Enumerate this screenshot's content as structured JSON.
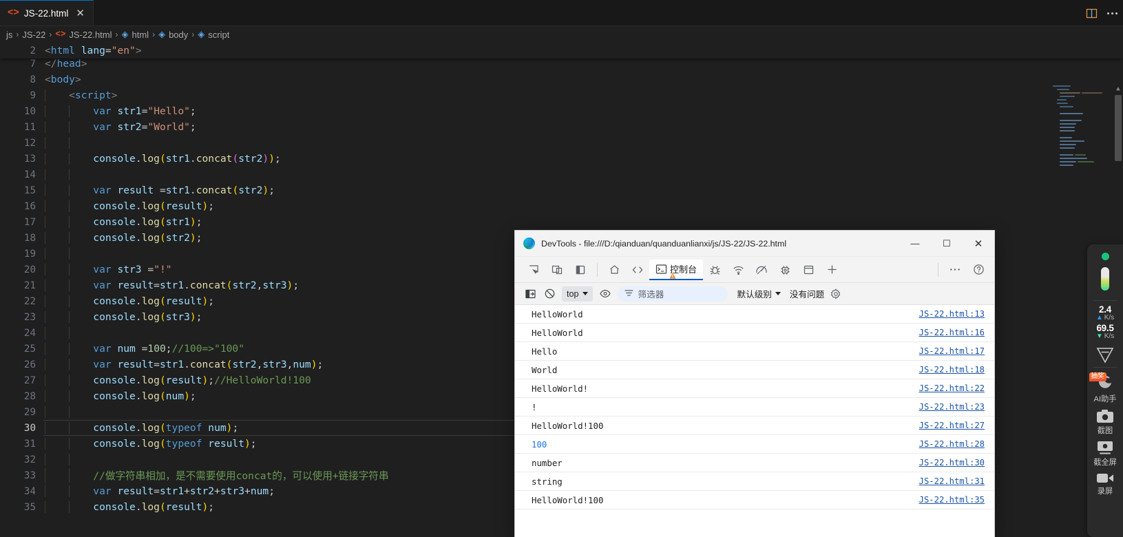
{
  "editor": {
    "tab": {
      "label": "JS-22.html",
      "icon": "html5-icon",
      "close_icon": "close-icon"
    },
    "titlebar_actions": {
      "split_label": "split-editor-icon",
      "more_label": "more-actions-icon"
    },
    "breadcrumb": [
      {
        "label": "js",
        "icon": "folder"
      },
      {
        "label": "JS-22",
        "icon": "folder"
      },
      {
        "label": "JS-22.html",
        "icon": "html5-icon"
      },
      {
        "label": "html",
        "icon": "symbol-cube-icon"
      },
      {
        "label": "body",
        "icon": "symbol-cube-icon"
      },
      {
        "label": "script",
        "icon": "symbol-cube-icon"
      }
    ],
    "breadcrumb_separator": "›",
    "current_line": 30,
    "lines": [
      {
        "n": "2",
        "sticky": true
      },
      {
        "n": "7"
      },
      {
        "n": "8"
      },
      {
        "n": "9"
      },
      {
        "n": "10"
      },
      {
        "n": "11"
      },
      {
        "n": "12"
      },
      {
        "n": "13"
      },
      {
        "n": "14"
      },
      {
        "n": "15"
      },
      {
        "n": "16"
      },
      {
        "n": "17"
      },
      {
        "n": "18"
      },
      {
        "n": "19"
      },
      {
        "n": "20"
      },
      {
        "n": "21"
      },
      {
        "n": "22"
      },
      {
        "n": "23"
      },
      {
        "n": "24"
      },
      {
        "n": "25"
      },
      {
        "n": "26"
      },
      {
        "n": "27"
      },
      {
        "n": "28"
      },
      {
        "n": "29"
      },
      {
        "n": "30"
      },
      {
        "n": "31"
      },
      {
        "n": "32"
      },
      {
        "n": "33"
      },
      {
        "n": "34"
      },
      {
        "n": "35"
      }
    ],
    "code_plain": [
      "<html lang=\"en\">",
      "</head>",
      "<body>",
      "    <script>",
      "        var str1=\"Hello\";",
      "        var str2=\"World\";",
      "",
      "        console.log(str1.concat(str2));",
      "",
      "        var result =str1.concat(str2);",
      "        console.log(result);",
      "        console.log(str1);",
      "        console.log(str2);",
      "",
      "        var str3 =\"!\"",
      "        var result=str1.concat(str2,str3);",
      "        console.log(result);",
      "        console.log(str3);",
      "",
      "        var num =100;//100=>\"100\"",
      "        var result=str1.concat(str2,str3,num);",
      "        console.log(result);//HelloWorld!100",
      "        console.log(num);",
      "",
      "        console.log(typeof num);",
      "        console.log(typeof result);",
      "",
      "        //做字符串相加，是不需要使用concat的，可以使用+链接字符串",
      "        var result=str1+str2+str3+num;",
      "        console.log(result);"
    ]
  },
  "devtools": {
    "title": "DevTools - file:///D:/qianduan/quanduanlianxi/js/JS-22/JS-22.html",
    "window_buttons": {
      "minimize": "—",
      "maximize": "☐",
      "close": "✕"
    },
    "toolbar_icons": [
      "inspect-element-icon",
      "device-toolbar-icon",
      "dock-side-icon",
      "welcome-home-icon",
      "elements-icon",
      "sources-debugger-icon",
      "network-icon",
      "performance-icon",
      "application-icon",
      "layers-icon",
      "more-tabs-plus-icon",
      "more-tools-icon",
      "help-icon"
    ],
    "active_tab": {
      "label": "控制台",
      "icon": "console-icon",
      "has_warning_badge": true
    },
    "more_label": "⋯",
    "help_label": "?",
    "filterbar": {
      "sidebar_toggle": "console-sidebar-icon",
      "clear_console": "clear-console-icon",
      "context": "top",
      "eye_icon": "live-expression-icon",
      "filter_icon": "filter-icon",
      "filter_placeholder": "筛选器",
      "filter_value": "",
      "level": "默认级别",
      "issues": "没有问题",
      "settings_icon": "settings-gear-icon"
    },
    "logs": [
      {
        "message": "HelloWorld",
        "type": "string",
        "source": "JS-22.html:13"
      },
      {
        "message": "HelloWorld",
        "type": "string",
        "source": "JS-22.html:16"
      },
      {
        "message": "Hello",
        "type": "string",
        "source": "JS-22.html:17"
      },
      {
        "message": "World",
        "type": "string",
        "source": "JS-22.html:18"
      },
      {
        "message": "HelloWorld!",
        "type": "string",
        "source": "JS-22.html:22"
      },
      {
        "message": "!",
        "type": "string",
        "source": "JS-22.html:23"
      },
      {
        "message": "HelloWorld!100",
        "type": "string",
        "source": "JS-22.html:27"
      },
      {
        "message": "100",
        "type": "number",
        "source": "JS-22.html:28"
      },
      {
        "message": "number",
        "type": "string",
        "source": "JS-22.html:30"
      },
      {
        "message": "string",
        "type": "string",
        "source": "JS-22.html:31"
      },
      {
        "message": "HelloWorld!100",
        "type": "string",
        "source": "JS-22.html:35"
      }
    ]
  },
  "floatbar": {
    "status_dot": "online-status-dot",
    "meter": "resource-meter",
    "upload": {
      "value": "2.4",
      "unit": "K/s",
      "arrow": "▲"
    },
    "download": {
      "value": "69.5",
      "unit": "K/s",
      "arrow": "▼"
    },
    "shield_icon": "security-shield-icon",
    "items": [
      {
        "label": "AI助手",
        "icon": "ai-assistant-icon",
        "badge": "抽奖"
      },
      {
        "label": "截图",
        "icon": "screenshot-icon",
        "badge": ""
      },
      {
        "label": "截全屏",
        "icon": "fullscreen-capture-icon",
        "badge": ""
      },
      {
        "label": "录屏",
        "icon": "screen-record-icon",
        "badge": ""
      }
    ]
  },
  "colors": {
    "editor_bg": "#1f1f1f",
    "tab_accent": "#0078d4",
    "devtools_accent": "#0b57d0",
    "log_link": "#1a54a8",
    "number_token": "#1a73e8"
  }
}
